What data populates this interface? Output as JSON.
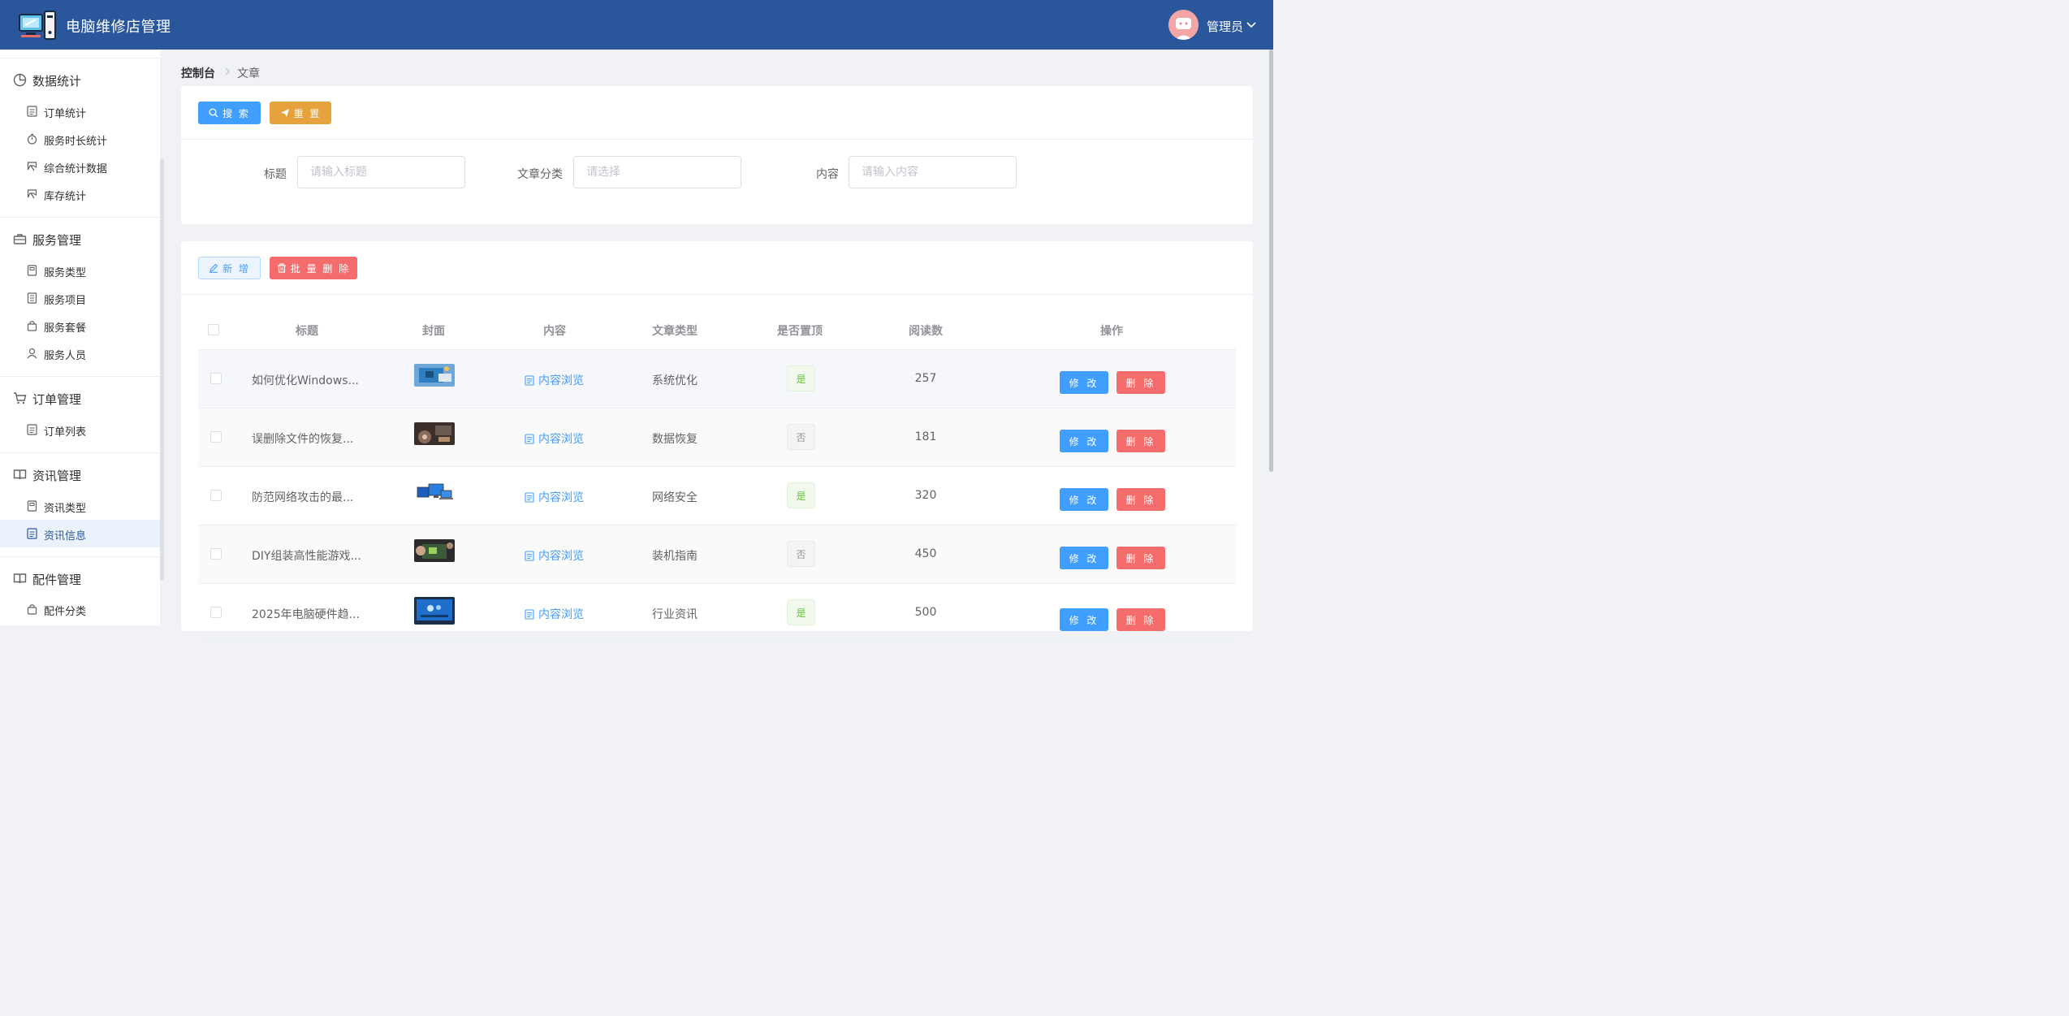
{
  "header": {
    "app_title": "电脑维修店管理",
    "user_name": "管理员",
    "logo_icon": "computer-repair-logo-icon",
    "avatar_icon": "user-avatar-icon",
    "bg_color": "#2a579c"
  },
  "sidebar": {
    "groups": [
      {
        "label": "数据统计",
        "icon": "pie-chart-icon",
        "items": [
          {
            "label": "订单统计",
            "icon": "document-icon"
          },
          {
            "label": "服务时长统计",
            "icon": "stopwatch-icon"
          },
          {
            "label": "综合统计数据",
            "icon": "trophy-icon"
          },
          {
            "label": "库存统计",
            "icon": "trophy-icon"
          }
        ]
      },
      {
        "label": "服务管理",
        "icon": "briefcase-icon",
        "items": [
          {
            "label": "服务类型",
            "icon": "notebook-icon"
          },
          {
            "label": "服务项目",
            "icon": "tickets-icon"
          },
          {
            "label": "服务套餐",
            "icon": "shopping-bag-icon"
          },
          {
            "label": "服务人员",
            "icon": "user-icon"
          }
        ]
      },
      {
        "label": "订单管理",
        "icon": "shopping-cart-icon",
        "items": [
          {
            "label": "订单列表",
            "icon": "document-icon"
          }
        ]
      },
      {
        "label": "资讯管理",
        "icon": "reading-icon",
        "items": [
          {
            "label": "资讯类型",
            "icon": "notebook-icon"
          },
          {
            "label": "资讯信息",
            "icon": "document-icon",
            "active": true
          }
        ]
      },
      {
        "label": "配件管理",
        "icon": "reading-icon",
        "items": [
          {
            "label": "配件分类",
            "icon": "shopping-bag-icon"
          }
        ]
      }
    ]
  },
  "breadcrumb": {
    "root": "控制台",
    "current": "文章"
  },
  "search": {
    "search_label": "搜 索",
    "reset_label": "重 置",
    "fields": [
      {
        "label": "标题",
        "placeholder": "请输入标题",
        "value": ""
      },
      {
        "label": "文章分类",
        "placeholder": "请选择",
        "value": ""
      },
      {
        "label": "内容",
        "placeholder": "请输入内容",
        "value": ""
      }
    ]
  },
  "toolbar": {
    "add_label": "新 增",
    "batch_delete_label": "批 量 删 除"
  },
  "table": {
    "columns": [
      "标题",
      "封面",
      "内容",
      "文章类型",
      "是否置顶",
      "阅读数",
      "操作"
    ],
    "link_label": "内容浏览",
    "edit_label": "修 改",
    "delete_label": "删 除",
    "rows": [
      {
        "title": "如何优化Windows...",
        "cover": "circuit-board-image",
        "type": "系统优化",
        "top": "是",
        "reads": "257"
      },
      {
        "title": "误删除文件的恢复...",
        "cover": "hardware-repair-image",
        "type": "数据恢复",
        "top": "否",
        "reads": "181"
      },
      {
        "title": "防范网络攻击的最...",
        "cover": "devices-image",
        "type": "网络安全",
        "top": "是",
        "reads": "320"
      },
      {
        "title": "DIY组装高性能游戏...",
        "cover": "pc-build-image",
        "type": "装机指南",
        "top": "否",
        "reads": "450"
      },
      {
        "title": "2025年电脑硬件趋...",
        "cover": "monitor-screen-image",
        "type": "行业资讯",
        "top": "是",
        "reads": "500"
      }
    ]
  },
  "colors": {
    "primary": "#409eff",
    "warning": "#e6a23c",
    "danger": "#f56c6c",
    "success": "#67c23a"
  }
}
